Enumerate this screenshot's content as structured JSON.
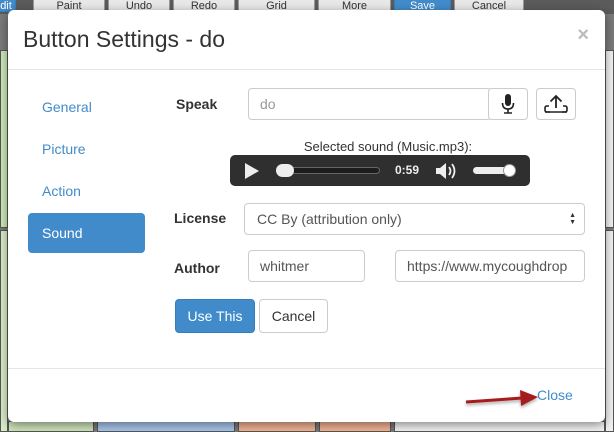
{
  "background": {
    "toolbar": [
      "Paint",
      "Undo",
      "Redo",
      "Grid",
      "More",
      "Save",
      "Cancel"
    ],
    "left_edge_label": "dit"
  },
  "modal": {
    "title": "Button Settings - do",
    "close_glyph": "×",
    "nav": [
      "General",
      "Picture",
      "Action",
      "Sound"
    ],
    "active_nav": "Sound",
    "speak": {
      "label": "Speak",
      "value": "do"
    },
    "selected_sound": "Selected sound (Music.mp3):",
    "player": {
      "time": "0:59",
      "progress": 0.0,
      "volume": 0.9
    },
    "license": {
      "label": "License",
      "value": "CC By (attribution only)"
    },
    "author": {
      "label": "Author",
      "name": "whitmer",
      "url": "https://www.mycoughdrop"
    },
    "buttons": {
      "use_this": "Use This",
      "cancel": "Cancel"
    },
    "footer": {
      "close": "Close"
    }
  },
  "colors": {
    "primary": "#428bca",
    "annotation_arrow": "#a61c1c"
  }
}
